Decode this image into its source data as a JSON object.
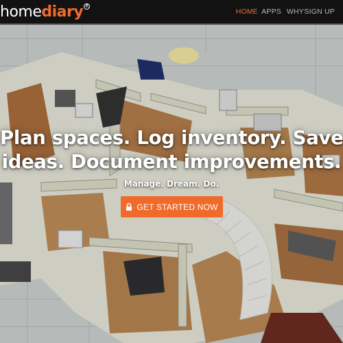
{
  "brand": {
    "logo_part1": "home",
    "logo_part2": "diary",
    "registered_mark": "R",
    "accent_color": "#f06a2c"
  },
  "nav": {
    "items": [
      {
        "label": "HOME",
        "active": true
      },
      {
        "label": "APPS",
        "active": false
      },
      {
        "label": "WHY",
        "active": false
      },
      {
        "label": "SIGN UP",
        "active": false
      }
    ]
  },
  "hero": {
    "headline_line1": "Plan spaces. Log inventory. Save",
    "headline_line2": "ideas. Document improvements.",
    "tagline": "Manage. Dream. Do.",
    "cta_label": "GET STARTED NOW",
    "cta_icon": "lock-icon",
    "background": "3D floor plan rendering of a house"
  }
}
